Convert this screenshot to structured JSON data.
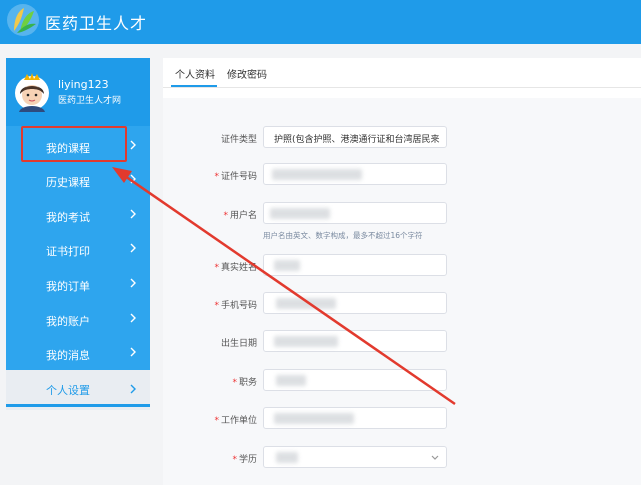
{
  "header": {
    "title": "医药卫生人才"
  },
  "profile": {
    "username": "liying123",
    "subtitle": "医药卫生人才网"
  },
  "sidebar": {
    "items": [
      {
        "label": "我的课程"
      },
      {
        "label": "历史课程"
      },
      {
        "label": "我的考试"
      },
      {
        "label": "证书打印"
      },
      {
        "label": "我的订单"
      },
      {
        "label": "我的账户"
      },
      {
        "label": "我的消息"
      }
    ],
    "settings_label": "个人设置"
  },
  "tabs": [
    {
      "label": "个人资料"
    },
    {
      "label": "修改密码"
    }
  ],
  "form": {
    "id_type": {
      "label": "证件类型",
      "value": "护照(包含护照、港澳通行证和台湾居民来"
    },
    "id_number": {
      "label": "证件号码"
    },
    "username": {
      "label": "用户名",
      "hint": "用户名由英文、数字构成，最多不超过16个字符"
    },
    "real_name": {
      "label": "真实姓名"
    },
    "phone": {
      "label": "手机号码"
    },
    "birthday": {
      "label": "出生日期"
    },
    "position": {
      "label": "职务"
    },
    "workplace": {
      "label": "工作单位"
    },
    "education": {
      "label": "学历"
    }
  },
  "colors": {
    "primary": "#1f9be9",
    "menu": "#2ea5ee",
    "annotation": "#e23a2e"
  }
}
